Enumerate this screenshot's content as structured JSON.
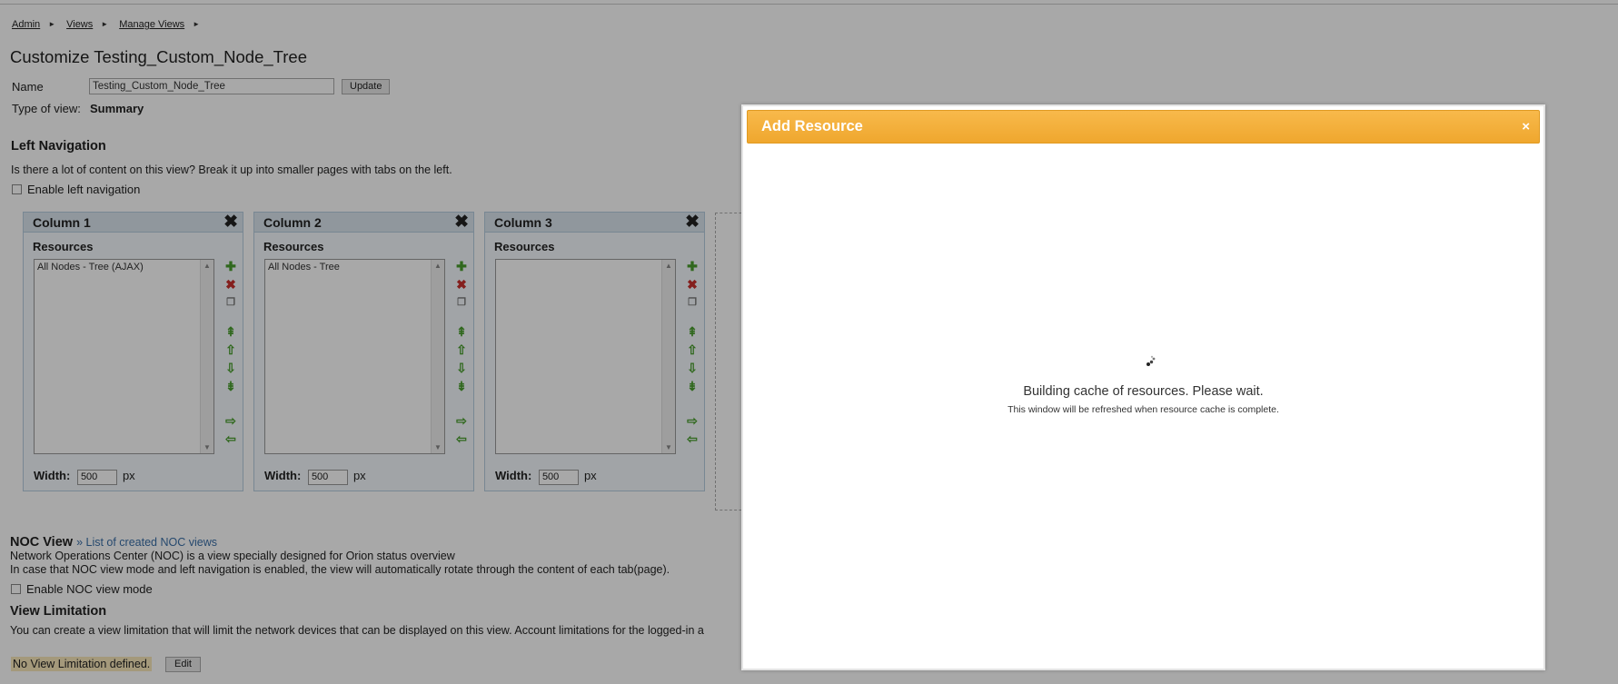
{
  "breadcrumb": [
    "Admin",
    "Views",
    "Manage Views"
  ],
  "page_title": "Customize Testing_Custom_Node_Tree",
  "name_form": {
    "label": "Name",
    "value": "Testing_Custom_Node_Tree",
    "update_label": "Update"
  },
  "type_of_view": {
    "label": "Type of view:",
    "value": "Summary"
  },
  "left_navigation": {
    "title": "Left Navigation",
    "description": "Is there a lot of content on this view? Break it up into smaller pages with tabs on the left.",
    "checkbox_label": "Enable left navigation"
  },
  "columns": [
    {
      "title": "Column 1",
      "resources_label": "Resources",
      "items": [
        "All Nodes - Tree (AJAX)"
      ],
      "width_label": "Width:",
      "width_value": "500",
      "unit": "px"
    },
    {
      "title": "Column 2",
      "resources_label": "Resources",
      "items": [
        "All Nodes - Tree"
      ],
      "width_label": "Width:",
      "width_value": "500",
      "unit": "px"
    },
    {
      "title": "Column 3",
      "resources_label": "Resources",
      "items": [],
      "width_label": "Width:",
      "width_value": "500",
      "unit": "px"
    }
  ],
  "noc": {
    "title": "NOC View",
    "link": "» List of created NOC views",
    "line1": "Network Operations Center (NOC) is a view specially designed for Orion status overview",
    "line2": "In case that NOC view mode and left navigation is enabled, the view will automatically rotate through the content of each tab(page).",
    "checkbox_label": "Enable NOC view mode"
  },
  "view_limitation": {
    "title": "View Limitation",
    "description": "You can create a view limitation that will limit the network devices that can be displayed on this view. Account limitations for the logged-in a",
    "status": "No View Limitation defined.",
    "edit_label": "Edit"
  },
  "dialog": {
    "title": "Add Resource",
    "close": "×",
    "message": "Building cache of resources. Please wait.",
    "submessage": "This window will be refreshed when resource cache is complete."
  },
  "colors": {
    "dialog_header": "#f5a93a",
    "column_header": "#dbe6ef",
    "overlay": "rgba(0,0,0,0.34)"
  }
}
